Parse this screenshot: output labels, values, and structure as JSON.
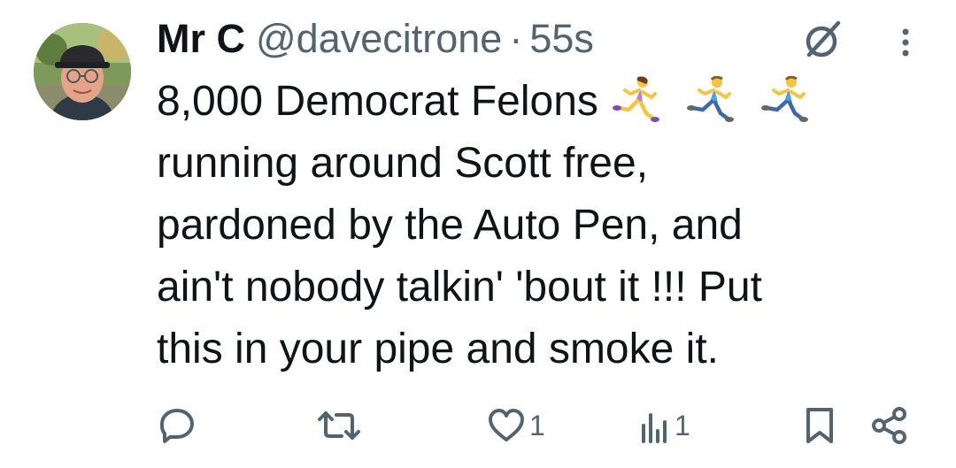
{
  "tweet": {
    "display_name": "Mr C",
    "handle": "@davecitrone",
    "separator": "·",
    "timestamp": "55s",
    "text_line1": "8,000 Democrat Felons",
    "text_rest": "running around Scott free,\npardoned by the Auto Pen, and\nain't nobody talkin' 'bout it  !!! Put\nthis in your pipe and smoke it.",
    "emoji": [
      "runner-woman",
      "runner-man",
      "runner-man"
    ]
  },
  "actions": {
    "reply_count": "",
    "retweet_count": "",
    "like_count": "1",
    "views_count": "1"
  },
  "colors": {
    "text": "#0f1419",
    "secondary": "#536471",
    "background": "#ffffff"
  },
  "icons": [
    "grok-icon",
    "more-icon",
    "reply-icon",
    "retweet-icon",
    "heart-icon",
    "views-icon",
    "bookmark-icon",
    "share-icon"
  ]
}
